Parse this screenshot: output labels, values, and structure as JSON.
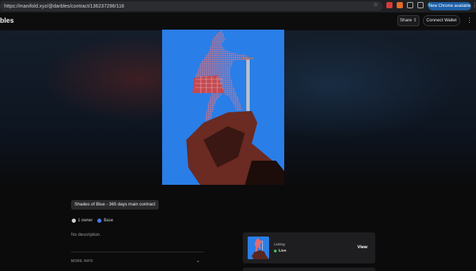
{
  "browser": {
    "url": "https://manifold.xyz/@darbles/contract/136237296/118",
    "update_label": "New Chrome available"
  },
  "header": {
    "site_title": "bles",
    "share_label": "Share",
    "connect_label": "Connect Wallet"
  },
  "nft": {
    "title": "Shades of Blue - 365 days main contract",
    "owners": "1 owner",
    "chain": "Base",
    "description": "No description.",
    "more_info_label": "MORE INFO"
  },
  "listing": {
    "label": "Listing",
    "status": "Live",
    "view_label": "View"
  },
  "colors": {
    "artwork_bg": "#2376e3",
    "live": "#3fbf5f",
    "update_pill": "#1d5fa8"
  }
}
